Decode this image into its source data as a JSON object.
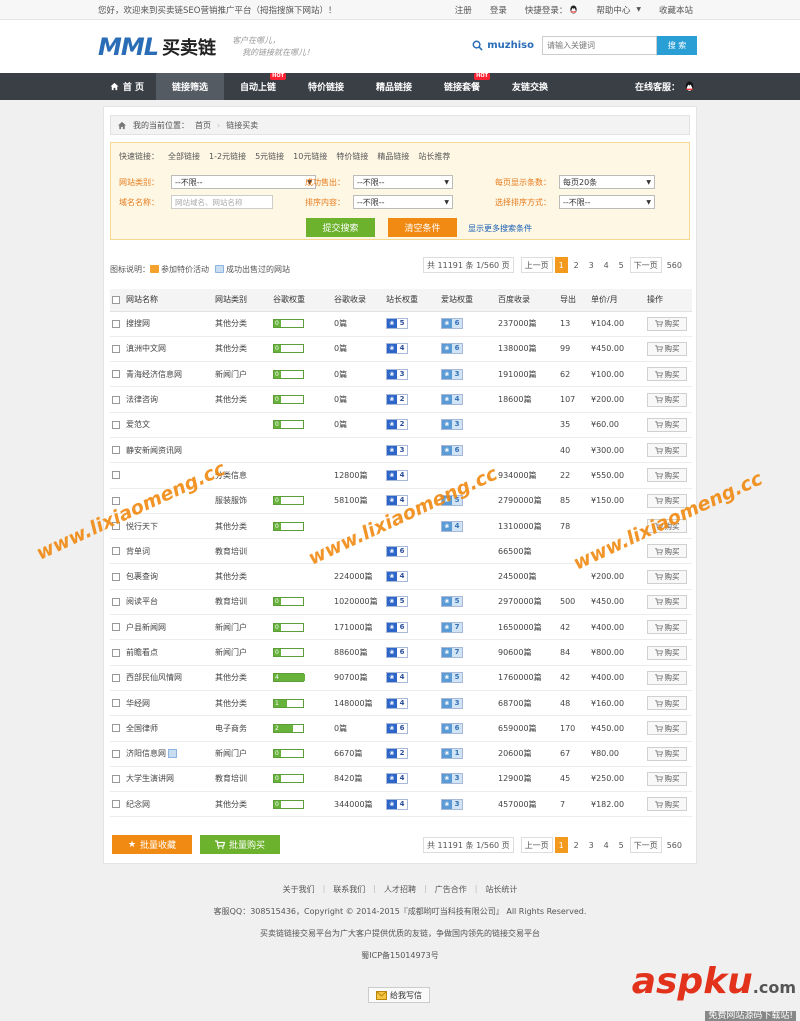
{
  "topbar": {
    "welcome": "您好，欢迎来到买卖链SEO营销推广平台（拇指搜旗下网站）！",
    "register": "注册",
    "login": "登录",
    "quick_login": "快捷登录：",
    "help": "帮助中心",
    "favorite": "收藏本站"
  },
  "header": {
    "logo_en": "MML",
    "logo_cn": "买卖链",
    "slogan_line1": "客户在哪儿，",
    "slogan_line2": "我的链接就在哪儿！",
    "search_brand": "muzhiso",
    "search_placeholder": "请输入关键词",
    "search_button": "搜 索"
  },
  "nav": {
    "items": [
      "首 页",
      "链接筛选",
      "自动上链",
      "特价链接",
      "精品链接",
      "链接套餐",
      "友链交换"
    ],
    "hot_label": "HOT",
    "new_label": "HOT",
    "service": "在线客服："
  },
  "breadcrumb": {
    "label": "我的当前位置：",
    "home": "首页",
    "current": "链接买卖"
  },
  "filter": {
    "quick_label": "快速链接：",
    "quick_links": [
      "全部链接",
      "1-2元链接",
      "5元链接",
      "10元链接",
      "特价链接",
      "精品链接",
      "站长推荐"
    ],
    "site_type_label": "网站类别：",
    "site_type_value": "--不限--",
    "success_label": "成功售出：",
    "success_value": "--不限--",
    "per_page_label": "每页显示条数：",
    "per_page_value": "每页20条",
    "domain_label": "域名名称：",
    "domain_placeholder": "网站域名、网站名称",
    "sort_content_label": "排序内容：",
    "sort_content_value": "--不限--",
    "sort_method_label": "选择排序方式：",
    "sort_method_value": "--不限--",
    "submit": "提交搜索",
    "clear": "清空条件",
    "more": "显示更多搜索条件"
  },
  "legend": {
    "title": "图标说明：",
    "special": "参加特价活动",
    "sold": "成功出售过的网站"
  },
  "pager": {
    "info": "共 11191 条 1/560 页",
    "prev": "上一页",
    "pages": [
      "1",
      "2",
      "3",
      "4",
      "5"
    ],
    "next": "下一页",
    "last": "560"
  },
  "table": {
    "headers": [
      "网站名称",
      "网站类别",
      "谷歌权重",
      "谷歌收录",
      "站长权重",
      "爱站权重",
      "百度收录",
      "导出",
      "单价/月",
      "操作"
    ],
    "buy_label": "购买",
    "rows": [
      {
        "name": "搜搜网",
        "cat": "其他分类",
        "pr": "0",
        "google": "0篇",
        "zz": "5",
        "az": "6",
        "baidu": "237000篇",
        "out": "13",
        "price": "¥104.00"
      },
      {
        "name": "滇洲中文网",
        "cat": "其他分类",
        "pr": "0",
        "google": "0篇",
        "zz": "4",
        "az": "6",
        "baidu": "138000篇",
        "out": "99",
        "price": "¥450.00"
      },
      {
        "name": "青海经济信息网",
        "cat": "新闻门户",
        "pr": "0",
        "google": "0篇",
        "zz": "3",
        "az": "3",
        "baidu": "191000篇",
        "out": "62",
        "price": "¥100.00"
      },
      {
        "name": "法律咨询",
        "cat": "其他分类",
        "pr": "0",
        "google": "0篇",
        "zz": "2",
        "az": "4",
        "baidu": "18600篇",
        "out": "107",
        "price": "¥200.00"
      },
      {
        "name": "爱范文",
        "cat": "",
        "pr": "0",
        "google": "0篇",
        "zz": "2",
        "az": "3",
        "baidu": "",
        "out": "35",
        "price": "¥60.00"
      },
      {
        "name": "静安新闻资讯网",
        "cat": "",
        "pr": "",
        "google": "",
        "zz": "3",
        "az": "6",
        "baidu": "",
        "out": "40",
        "price": "¥300.00"
      },
      {
        "name": "",
        "cat": "分类信息",
        "pr": "",
        "google": "12800篇",
        "zz": "4",
        "az": "",
        "baidu": "934000篇",
        "out": "22",
        "price": "¥550.00"
      },
      {
        "name": "",
        "cat": "服装服饰",
        "pr": "0",
        "google": "58100篇",
        "zz": "4",
        "az": "5",
        "baidu": "2790000篇",
        "out": "85",
        "price": "¥150.00"
      },
      {
        "name": "悦行天下",
        "cat": "其他分类",
        "pr": "0",
        "google": "",
        "zz": "",
        "az": "4",
        "baidu": "1310000篇",
        "out": "78",
        "price": ""
      },
      {
        "name": "背单词",
        "cat": "教育培训",
        "pr": "",
        "google": "",
        "zz": "6",
        "az": "",
        "baidu": "66500篇",
        "out": "",
        "price": ""
      },
      {
        "name": "包裹查询",
        "cat": "其他分类",
        "pr": "",
        "google": "224000篇",
        "zz": "4",
        "az": "",
        "baidu": "245000篇",
        "out": "",
        "price": "¥200.00"
      },
      {
        "name": "阅读平台",
        "cat": "教育培训",
        "pr": "0",
        "google": "1020000篇",
        "zz": "5",
        "az": "5",
        "baidu": "2970000篇",
        "out": "500",
        "price": "¥450.00"
      },
      {
        "name": "户县新闻网",
        "cat": "新闻门户",
        "pr": "0",
        "google": "171000篇",
        "zz": "6",
        "az": "7",
        "baidu": "1650000篇",
        "out": "42",
        "price": "¥400.00"
      },
      {
        "name": "前瞻看点",
        "cat": "新闻门户",
        "pr": "0",
        "google": "88600篇",
        "zz": "6",
        "az": "7",
        "baidu": "90600篇",
        "out": "84",
        "price": "¥800.00"
      },
      {
        "name": "西部民仙风情网",
        "cat": "其他分类",
        "pr": "4",
        "google": "90700篇",
        "zz": "4",
        "az": "5",
        "baidu": "1760000篇",
        "out": "42",
        "price": "¥400.00"
      },
      {
        "name": "华经网",
        "cat": "其他分类",
        "pr": "1",
        "google": "148000篇",
        "zz": "4",
        "az": "3",
        "baidu": "68700篇",
        "out": "48",
        "price": "¥160.00"
      },
      {
        "name": "全国律师",
        "cat": "电子商务",
        "pr": "2",
        "google": "0篇",
        "zz": "6",
        "az": "6",
        "baidu": "659000篇",
        "out": "170",
        "price": "¥450.00"
      },
      {
        "name": "济阳信息网",
        "cat": "新闻门户",
        "pr": "0",
        "google": "6670篇",
        "zz": "2",
        "az": "1",
        "baidu": "20600篇",
        "out": "67",
        "price": "¥80.00"
      },
      {
        "name": "大学生演讲网",
        "cat": "教育培训",
        "pr": "0",
        "google": "8420篇",
        "zz": "4",
        "az": "3",
        "baidu": "12900篇",
        "out": "45",
        "price": "¥250.00"
      },
      {
        "name": "纪念网",
        "cat": "其他分类",
        "pr": "0",
        "google": "344000篇",
        "zz": "4",
        "az": "3",
        "baidu": "457000篇",
        "out": "7",
        "price": "¥182.00"
      }
    ]
  },
  "actions": {
    "fav": "批量收藏",
    "batch_buy": "批量购买"
  },
  "footer": {
    "links": [
      "关于我们",
      "联系我们",
      "人才招聘",
      "广告合作",
      "站长统计"
    ],
    "line1": "客服QQ：308515436，Copyright © 2014-2015『成都哟叮当科技有限公司』 All Rights Reserved.",
    "line2": "买卖链链接交易平台为广大客户提供优质的友链，争做国内领先的链接交易平台",
    "icp": "蜀ICP备15014973号",
    "guestbook": "给我写信"
  },
  "watermark": {
    "text": "www.lixiaomeng.cc"
  },
  "corner": {
    "brand": "aspku",
    "tld": ".com",
    "sub": "免费网站源码下载站!"
  }
}
